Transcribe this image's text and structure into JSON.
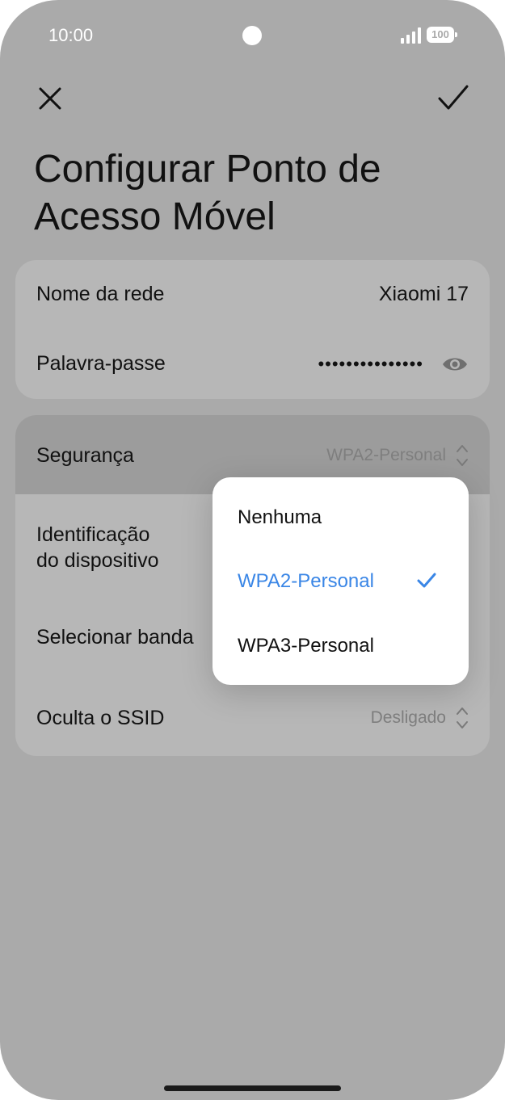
{
  "status_bar": {
    "time": "10:00",
    "battery": "100"
  },
  "header": {
    "title": "Configurar Ponto de Acesso Móvel"
  },
  "network": {
    "name_label": "Nome da rede",
    "name_value": "Xiaomi 17",
    "password_label": "Palavra-passe",
    "password_value": "•••••••••••••••"
  },
  "settings": {
    "security_label": "Segurança",
    "security_value": "WPA2-Personal",
    "device_id_label_line1": "Identificação",
    "device_id_label_line2": "do dispositivo",
    "band_label": "Selecionar banda",
    "hidden_ssid_label": "Oculta o SSID",
    "hidden_ssid_value": "Desligado"
  },
  "security_dropdown": {
    "options": [
      "Nenhuma",
      "WPA2-Personal",
      "WPA3-Personal"
    ],
    "selected": "WPA2-Personal"
  },
  "colors": {
    "accent": "#3a86e6",
    "background": "#aaaaaa",
    "card": "#b7b7b7",
    "highlight_row": "#9c9c9c"
  },
  "icons": [
    "close-icon",
    "checkmark-icon",
    "eye-icon",
    "chevron-updown-icon",
    "signal-icon",
    "battery-icon"
  ]
}
